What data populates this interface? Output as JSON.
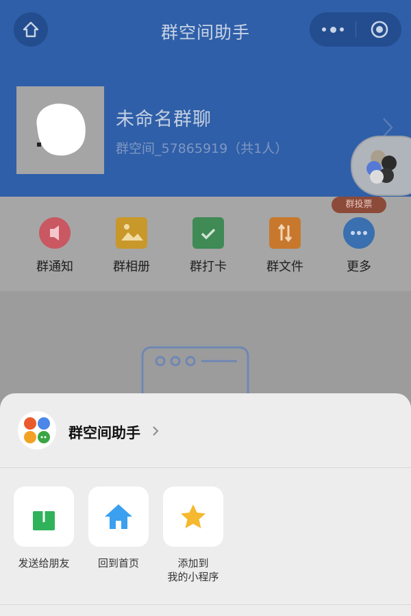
{
  "header": {
    "title": "群空间助手",
    "home_icon": "home-icon",
    "more_icon": "more-dots-icon",
    "close_icon": "target-circle-icon",
    "background": "#2f5fa8"
  },
  "group": {
    "name": "未命名群聊",
    "id_line": "群空间_57865919（共1人）"
  },
  "features": [
    {
      "label": "群通知",
      "icon": "megaphone-icon",
      "color": "#c95862"
    },
    {
      "label": "群相册",
      "icon": "picture-icon",
      "color": "#c9982a"
    },
    {
      "label": "群打卡",
      "icon": "checkin-icon",
      "color": "#3f8a55"
    },
    {
      "label": "群文件",
      "icon": "file-icon",
      "color": "#c8782d"
    },
    {
      "label": "更多",
      "icon": "more-circle-icon",
      "color": "#3a6fb0"
    }
  ],
  "badge": {
    "vote": "群投票"
  },
  "sheet": {
    "app_name": "群空间助手",
    "actions": [
      {
        "label": "发送给朋友",
        "icon": "share-icon",
        "color": "#2fb25a"
      },
      {
        "label": "回到首页",
        "icon": "home-icon",
        "color": "#3aa0ef"
      },
      {
        "label_line1": "添加到",
        "label_line2": "我的小程序",
        "icon": "star-icon",
        "color": "#f5b82e"
      }
    ]
  }
}
